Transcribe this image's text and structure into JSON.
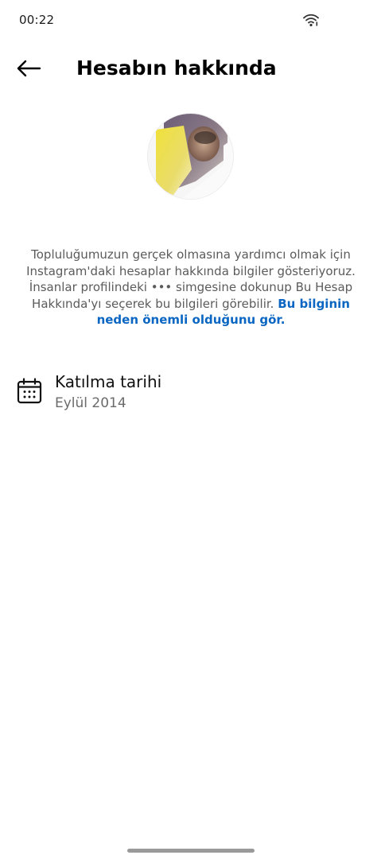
{
  "status_bar": {
    "time": "00:22",
    "wifi_icon": "wifi-icon"
  },
  "header": {
    "back_icon": "arrow-left-icon",
    "title": "Hesabın hakkında"
  },
  "avatar": {
    "description_icon": "profile-photo"
  },
  "description": {
    "text": "Topluluğumuzun gerçek olmasına yardımcı olmak için Instagram'daki hesaplar hakkında bilgiler gösteriyoruz. İnsanlar profilindeki ••• simgesine dokunup Bu Hesap Hakkında'yı seçerek bu bilgileri görebilir. ",
    "link": "Bu bilginin neden önemli olduğunu gör."
  },
  "info": {
    "icon": "calendar-icon",
    "label": "Katılma tarihi",
    "value": "Eylül 2014"
  },
  "colors": {
    "link": "#0a66c2",
    "text_secondary": "#5b5b5b"
  }
}
